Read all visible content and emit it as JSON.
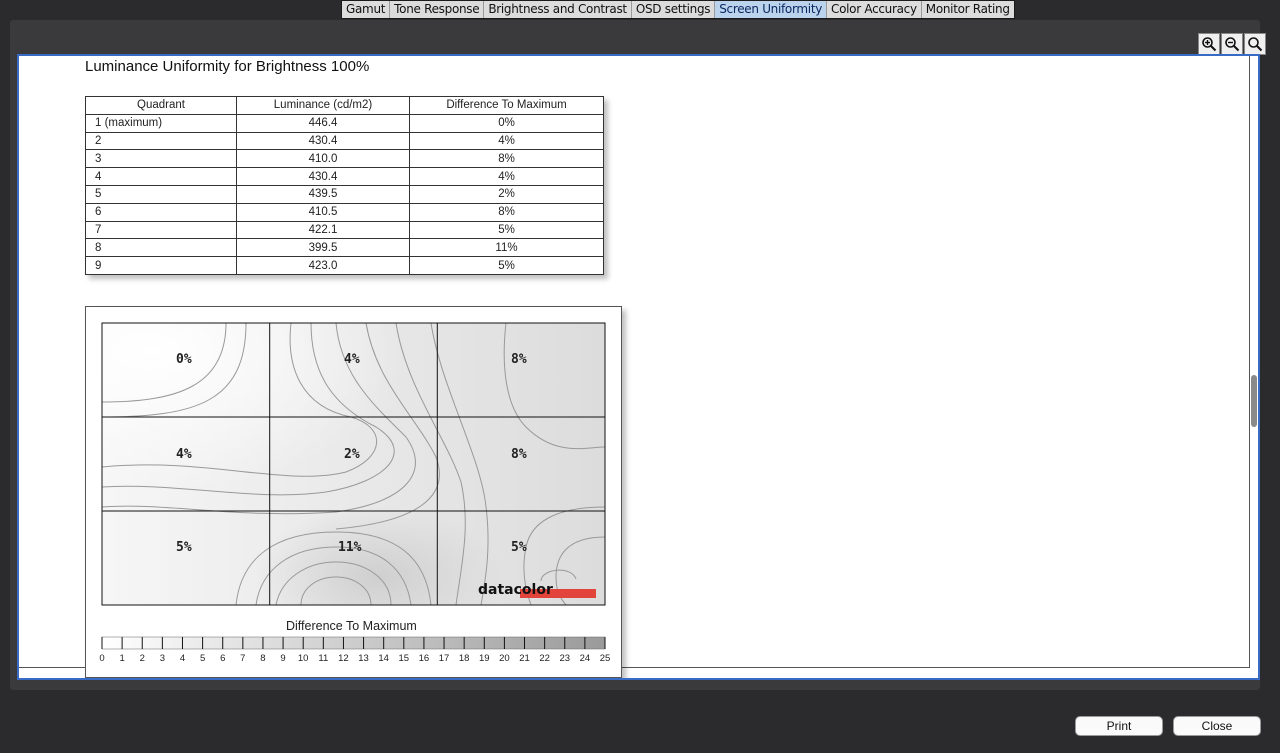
{
  "tabs": [
    {
      "label": "Gamut",
      "active": false
    },
    {
      "label": "Tone Response",
      "active": false
    },
    {
      "label": "Brightness and Contrast",
      "active": false
    },
    {
      "label": "OSD settings",
      "active": false
    },
    {
      "label": "Screen Uniformity",
      "active": true
    },
    {
      "label": "Color Accuracy",
      "active": false
    },
    {
      "label": "Monitor Rating",
      "active": false
    }
  ],
  "zoom": {
    "zoom_in_icon": "zoom-in-icon",
    "zoom_out_icon": "zoom-out-icon",
    "zoom_fit_icon": "zoom-fit-icon"
  },
  "report": {
    "title": "Luminance Uniformity for Brightness 100%",
    "table": {
      "headers": [
        "Quadrant",
        "Luminance (cd/m2)",
        "Difference To Maximum"
      ],
      "rows": [
        [
          "1 (maximum)",
          "446.4",
          "0%"
        ],
        [
          "2",
          "430.4",
          "4%"
        ],
        [
          "3",
          "410.0",
          "8%"
        ],
        [
          "4",
          "430.4",
          "4%"
        ],
        [
          "5",
          "439.5",
          "2%"
        ],
        [
          "6",
          "410.5",
          "8%"
        ],
        [
          "7",
          "422.1",
          "5%"
        ],
        [
          "8",
          "399.5",
          "11%"
        ],
        [
          "9",
          "423.0",
          "5%"
        ]
      ]
    },
    "map": {
      "cells": [
        "0%",
        "4%",
        "8%",
        "4%",
        "2%",
        "8%",
        "5%",
        "11%",
        "5%"
      ],
      "brand": "datacolor",
      "brand_color": "#e2433a",
      "legend_title": "Difference To Maximum",
      "legend_ticks": [
        "0",
        "1",
        "2",
        "3",
        "4",
        "5",
        "6",
        "7",
        "8",
        "9",
        "10",
        "11",
        "12",
        "13",
        "14",
        "15",
        "16",
        "17",
        "18",
        "19",
        "20",
        "21",
        "22",
        "23",
        "24",
        "25"
      ]
    }
  },
  "buttons": {
    "print": "Print",
    "close": "Close"
  },
  "colors": {
    "active_tab": "#bcd3ee",
    "viewport_border": "#3a6bc4",
    "background": "#2b2b2d"
  }
}
